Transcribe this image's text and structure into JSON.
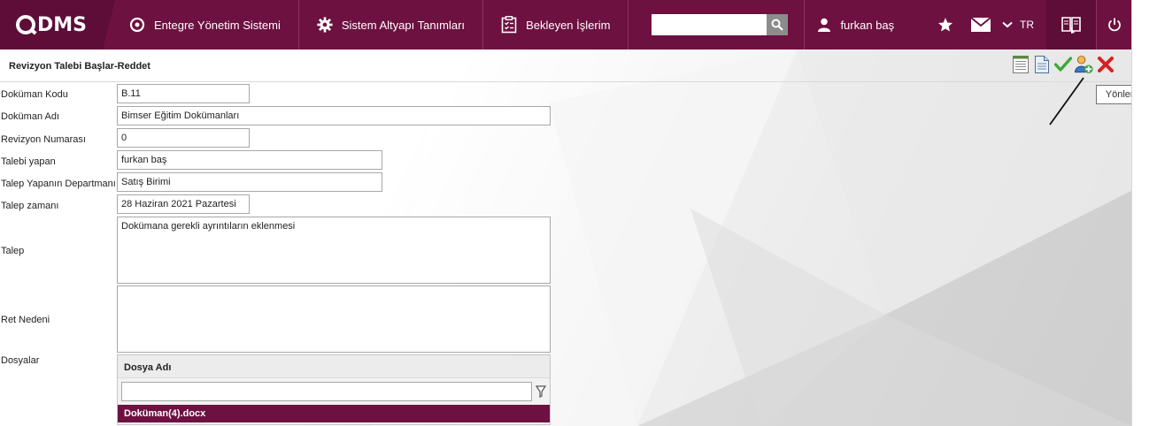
{
  "nav": {
    "logo_text": "DMS",
    "items": [
      {
        "label": "Entegre Yönetim Sistemi"
      },
      {
        "label": "Sistem Altyapı Tanımları"
      },
      {
        "label": "Bekleyen İşlerim"
      }
    ],
    "search_value": "",
    "user_name": "furkan baş",
    "language": "TR"
  },
  "page": {
    "title": "Revizyon Talebi Başlar-Reddet",
    "tooltip": "Yönlendir"
  },
  "form": {
    "fields": [
      {
        "label": "Doküman Kodu",
        "value": "B.11"
      },
      {
        "label": "Doküman Adı",
        "value": "Bimser Eğitim Dokümanları"
      },
      {
        "label": "Revizyon Numarası",
        "value": "0"
      },
      {
        "label": "Talebi yapan",
        "value": "furkan baş"
      },
      {
        "label": "Talep Yapanın Departmanı",
        "value": "Satış Birimi"
      },
      {
        "label": "Talep zamanı",
        "value": "28 Haziran 2021 Pazartesi"
      }
    ],
    "talep_label": "Talep",
    "talep_value": "Dokümana gerekli ayrıntıların eklenmesi",
    "ret_label": "Ret Nedeni",
    "ret_value": "",
    "files_label": "Dosyalar",
    "files_column": "Dosya Adı",
    "files_filter": "",
    "files": [
      "Doküman(4).docx"
    ]
  },
  "colors": {
    "brand": "#6d1141",
    "brand_dark": "#5d0d37"
  }
}
